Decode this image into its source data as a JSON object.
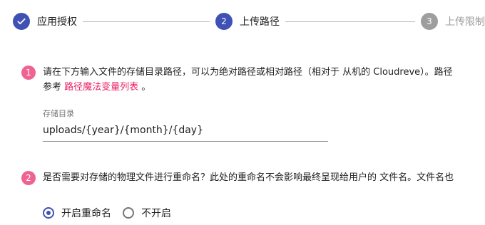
{
  "stepper": {
    "steps": [
      {
        "number": "1",
        "label": "应用授权",
        "state": "done",
        "icon": "check-icon"
      },
      {
        "number": "2",
        "label": "上传路径",
        "state": "active"
      },
      {
        "number": "3",
        "label": "上传限制",
        "state": "pending"
      }
    ]
  },
  "section1": {
    "number": "1",
    "text_line1": "请在下方输入文件的存储目录路径，可以为绝对路径或相对路径（相对于 从机的 Cloudreve）。路径",
    "text_prefix": "参考 ",
    "link_text": "路径魔法变量列表",
    "text_suffix": " 。",
    "field_label": "存储目录",
    "field_value": "uploads/{year}/{month}/{day}"
  },
  "section2": {
    "number": "2",
    "text": "是否需要对存储的物理文件进行重命名？此处的重命名不会影响最终呈现给用户的 文件名。文件名也",
    "options": [
      {
        "label": "开启重命名",
        "checked": true
      },
      {
        "label": "不开启",
        "checked": false
      }
    ]
  },
  "colors": {
    "primary": "#3f51b5",
    "badge": "#f06292",
    "link": "#e91e63",
    "pending": "#9e9e9e"
  }
}
